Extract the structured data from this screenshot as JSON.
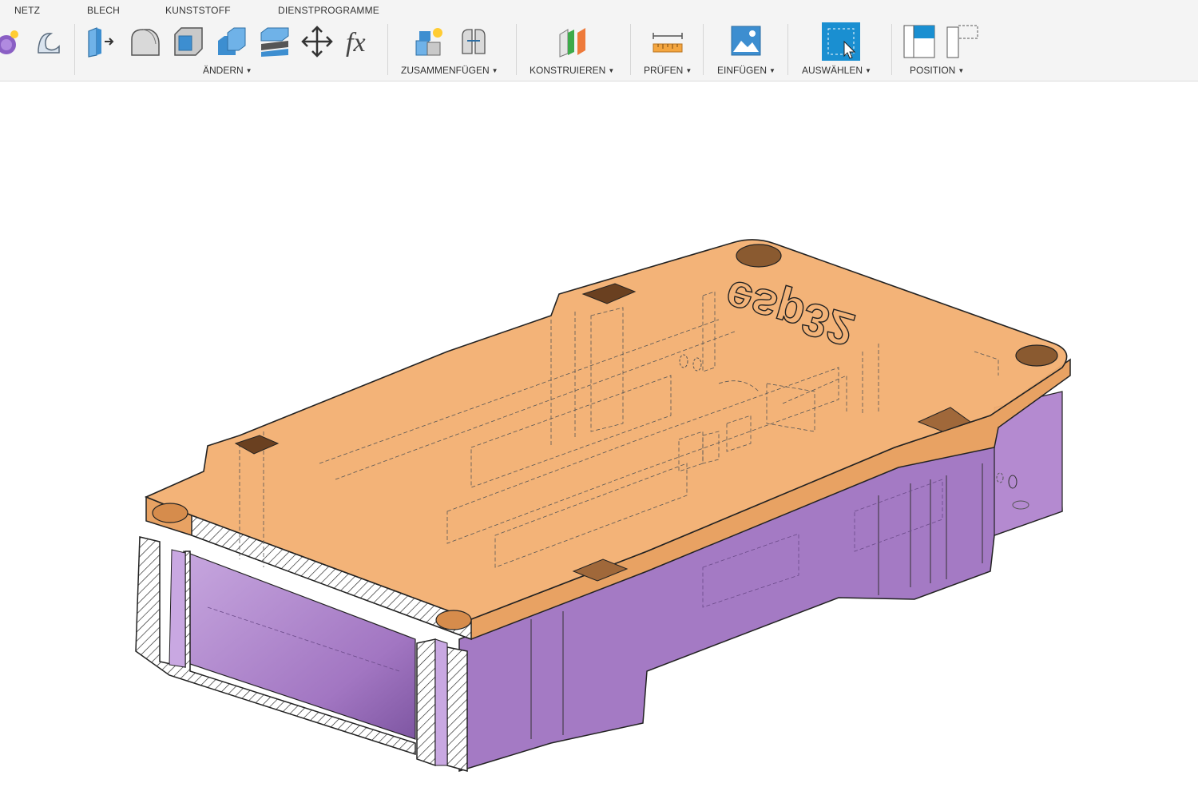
{
  "tabs": [
    {
      "id": "netz",
      "label": "NETZ"
    },
    {
      "id": "blech",
      "label": "BLECH"
    },
    {
      "id": "kunststoff",
      "label": "KUNSTSTOFF"
    },
    {
      "id": "dienstprogramme",
      "label": "DIENSTPROGRAMME"
    }
  ],
  "groups": {
    "aendern": {
      "label": "ÄNDERN"
    },
    "zusammenfuegen": {
      "label": "ZUSAMMENFÜGEN"
    },
    "konstruieren": {
      "label": "KONSTRUIEREN"
    },
    "pruefen": {
      "label": "PRÜFEN"
    },
    "einfuegen": {
      "label": "EINFÜGEN"
    },
    "auswaehlen": {
      "label": "AUSWÄHLEN"
    },
    "position": {
      "label": "POSITION"
    }
  },
  "icons": [
    "create-form-icon",
    "revolve-sweep-icon",
    "press-pull-icon",
    "fillet-icon",
    "shell-icon",
    "combine-icon",
    "split-body-icon",
    "move-icon",
    "parameters-fx-icon",
    "new-component-icon",
    "joint-icon",
    "offset-plane-icon",
    "measure-icon",
    "insert-canvas-icon",
    "select-icon",
    "capture-position-icon",
    "revert-position-icon"
  ],
  "fx_label": "fx",
  "model": {
    "lid_color": "#F2B072",
    "base_color": "#A47AC4",
    "engraved_text": "esp32"
  },
  "colors": {
    "toolbar_bg": "#f4f4f4",
    "select_active": "#1A8FD1",
    "separator": "#d6d6d6"
  }
}
